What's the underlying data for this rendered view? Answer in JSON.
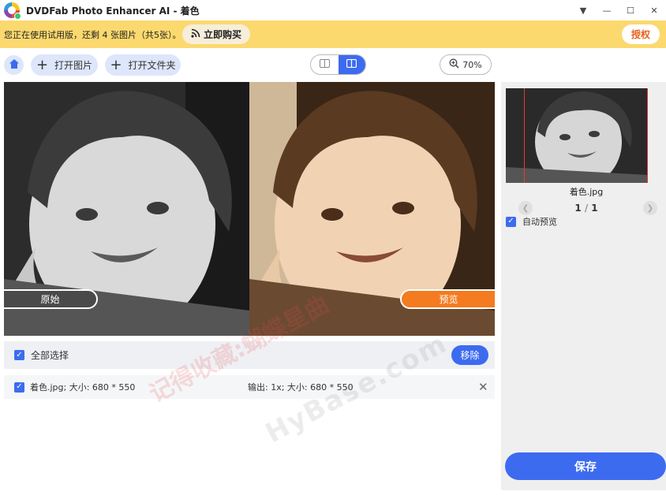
{
  "window": {
    "title": "DVDFab Photo Enhancer AI - 着色",
    "controls": [
      "▼",
      "—",
      "☐",
      "✕"
    ]
  },
  "banner": {
    "text": "您正在使用试用版，还剩 4 张图片（共5张）。",
    "buy_label": "立即购买",
    "auth_label": "授权"
  },
  "toolbar": {
    "open_image": "打开图片",
    "open_folder": "打开文件夹",
    "zoom": "70%"
  },
  "preview": {
    "original_label": "原始",
    "preview_label": "预览"
  },
  "list": {
    "select_all": "全部选择",
    "remove": "移除",
    "files": [
      {
        "name": "着色.jpg; 大小: 680 * 550",
        "output": "输出: 1x; 大小: 680 * 550"
      }
    ]
  },
  "watermark": {
    "cn": "记得收藏:蝴蝶星曲",
    "en": "HyBase.com"
  },
  "sidebar": {
    "thumb_name": "着色.jpg",
    "page_current": "1",
    "page_sep": "/",
    "page_total": "1",
    "auto_preview": "自动预览",
    "save": "保存"
  },
  "colors": {
    "accent": "#3d6bf0",
    "banner": "#fcd96e",
    "preview_label": "#f47b20",
    "auth_text": "#e8601c"
  }
}
